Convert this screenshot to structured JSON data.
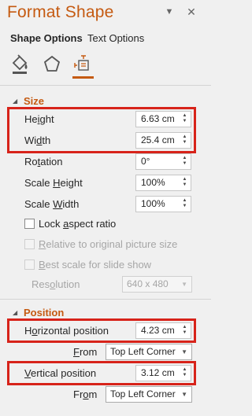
{
  "pane": {
    "title": "Format Shape"
  },
  "tabs": [
    {
      "label": "Shape Options",
      "active": true
    },
    {
      "label": "Text Options",
      "active": false
    }
  ],
  "category_icons": [
    "fill-line-icon",
    "effects-icon",
    "size-properties-icon"
  ],
  "size": {
    "title": "Size",
    "height": {
      "label": "Height",
      "value": "6.63 cm"
    },
    "width": {
      "label": "Width",
      "value": "25.4 cm"
    },
    "rotation": {
      "label": "Rotation",
      "value": "0°"
    },
    "scale_height": {
      "label": "Scale Height",
      "value": "100%"
    },
    "scale_width": {
      "label": "Scale Width",
      "value": "100%"
    },
    "lock_aspect": "Lock aspect ratio",
    "relative_original": "Relative to original picture size",
    "best_scale": "Best scale for slide show",
    "resolution": {
      "label": "Resolution",
      "value": "640 x 480"
    }
  },
  "position": {
    "title": "Position",
    "horizontal": {
      "label": "Horizontal position",
      "value": "4.23 cm",
      "from_label": "From",
      "from_value": "Top Left Corner"
    },
    "vertical": {
      "label": "Vertical position",
      "value": "3.12 cm",
      "from_label": "From",
      "from_value": "Top Left Corner"
    }
  },
  "colors": {
    "accent": "#c55a11",
    "highlight": "#d7231a"
  }
}
